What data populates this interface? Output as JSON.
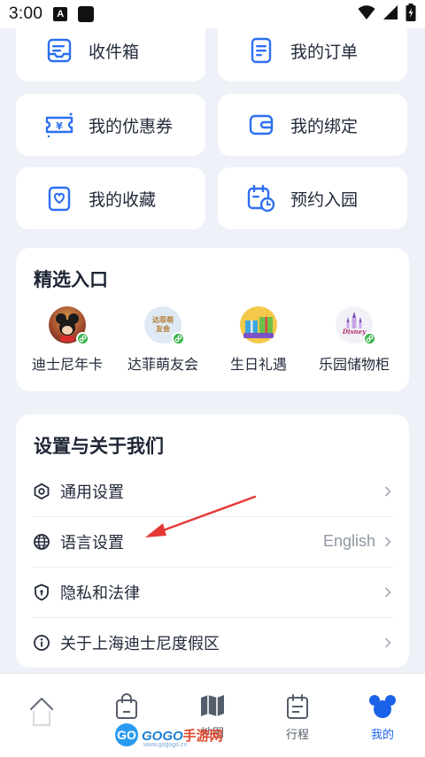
{
  "status_bar": {
    "time": "3:00",
    "a_icon_text": "A"
  },
  "tiles": [
    {
      "label": "收件箱",
      "icon": "inbox-icon"
    },
    {
      "label": "我的订单",
      "icon": "order-list-icon"
    },
    {
      "label": "我的优惠券",
      "icon": "coupon-icon"
    },
    {
      "label": "我的绑定",
      "icon": "wallet-icon"
    },
    {
      "label": "我的收藏",
      "icon": "heart-bookmark-icon"
    },
    {
      "label": "预约入园",
      "icon": "calendar-clock-icon"
    }
  ],
  "featured": {
    "title": "精选入口",
    "items": [
      {
        "label": "迪士尼年卡",
        "icon": "mickey-avatar-icon",
        "badge": "mini-program-icon"
      },
      {
        "label": "达菲萌友会",
        "icon": "duffy-club-icon",
        "badge": "mini-program-icon",
        "avatar_text": "达菲萌友会"
      },
      {
        "label": "生日礼遇",
        "icon": "gift-boxes-icon"
      },
      {
        "label": "乐园储物柜",
        "icon": "disney-castle-icon",
        "badge": "mini-program-icon"
      }
    ]
  },
  "settings": {
    "title": "设置与关于我们",
    "rows": [
      {
        "label": "通用设置",
        "icon": "hexagon-settings-icon",
        "value": ""
      },
      {
        "label": "语言设置",
        "icon": "globe-icon",
        "value": "English"
      },
      {
        "label": "隐私和法律",
        "icon": "shield-lock-icon",
        "value": ""
      },
      {
        "label": "关于上海迪士尼度假区",
        "icon": "info-icon",
        "value": ""
      }
    ]
  },
  "bottom_nav": [
    {
      "label": "",
      "icon": "home-icon",
      "active": false
    },
    {
      "label": "商城",
      "icon": "shopping-bag-icon",
      "active": false
    },
    {
      "label": "地图",
      "icon": "map-icon",
      "active": false
    },
    {
      "label": "行程",
      "icon": "calendar-icon",
      "active": false
    },
    {
      "label": "我的",
      "icon": "mickey-head-icon",
      "active": true
    }
  ],
  "watermark": {
    "circle": "GO",
    "text": "GOGO",
    "text_cn": "手游网",
    "sub": "www.gogogo.cn"
  },
  "colors": {
    "accent": "#1a62e8",
    "icon_blue": "#2d6ff0",
    "badge_green": "#39b54a",
    "annotation_red": "#e53935",
    "page_bg": "#eef1f7"
  }
}
